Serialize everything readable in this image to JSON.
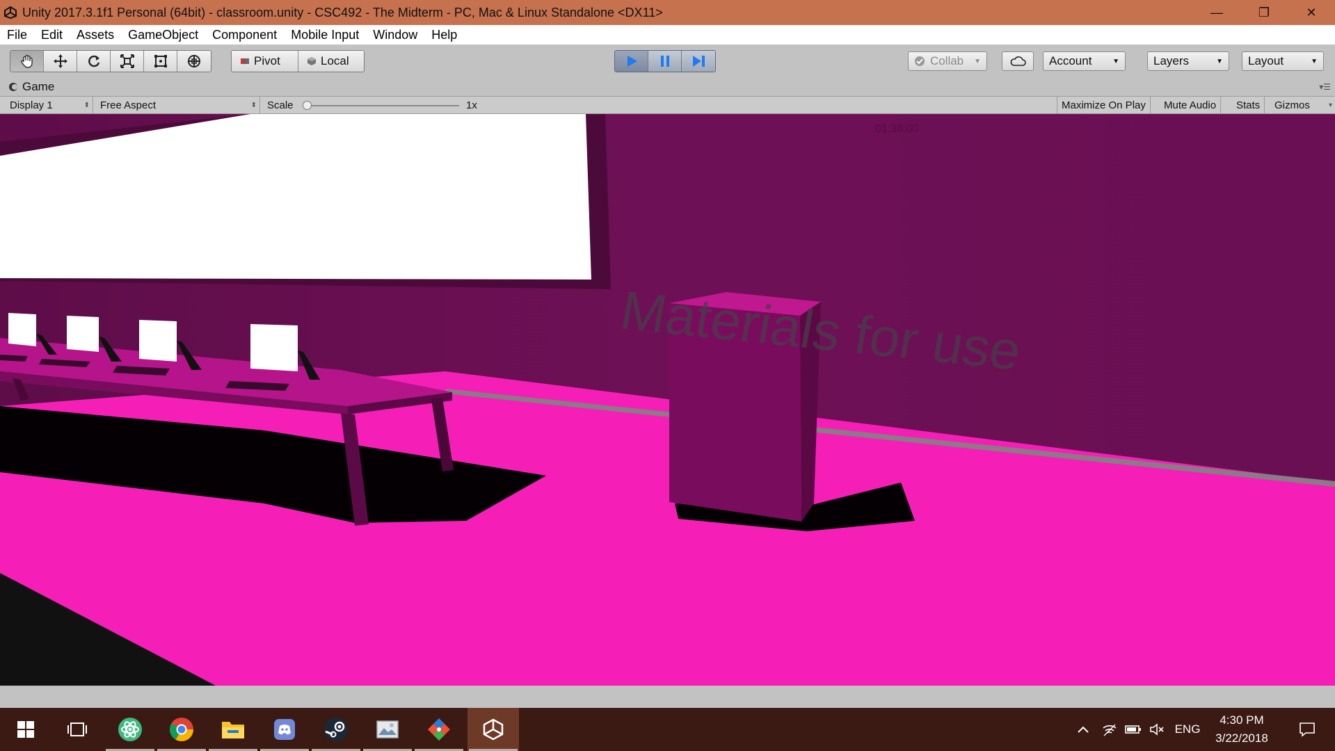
{
  "window": {
    "title": "Unity 2017.3.1f1 Personal (64bit) - classroom.unity - CSC492 - The Midterm - PC, Mac & Linux Standalone <DX11>",
    "minimize": "—",
    "restore": "❐",
    "close": "✕"
  },
  "menu": [
    "File",
    "Edit",
    "Assets",
    "GameObject",
    "Component",
    "Mobile Input",
    "Window",
    "Help"
  ],
  "toolbar": {
    "tools": [
      "hand-tool-icon",
      "move-tool-icon",
      "rotate-tool-icon",
      "scale-tool-icon",
      "rect-tool-icon",
      "transform-tool-icon"
    ],
    "pivot": "Pivot",
    "local": "Local",
    "collab": "Collab",
    "account": "Account",
    "layers": "Layers",
    "layout": "Layout"
  },
  "game_tab": {
    "label": "Game"
  },
  "game_bar": {
    "display": "Display 1",
    "aspect": "Free Aspect",
    "scale_label": "Scale",
    "scale_value": "1x",
    "maximize": "Maximize On Play",
    "mute": "Mute Audio",
    "stats": "Stats",
    "gizmos": "Gizmos"
  },
  "scene": {
    "wall_text": "Materials for use",
    "counter_text": "01:38:00",
    "colors": {
      "wall": "#6b0f53",
      "floor": "#f51fb8",
      "screen": "#ffffff",
      "shadow": "#000000"
    }
  },
  "taskbar": {
    "apps": [
      "start-icon",
      "task-view-icon",
      "atom-icon",
      "chrome-icon",
      "file-explorer-icon",
      "discord-icon",
      "steam-icon",
      "photos-icon",
      "git-icon",
      "unity-icon"
    ],
    "lang": "ENG",
    "time": "4:30 PM",
    "date": "3/22/2018"
  }
}
